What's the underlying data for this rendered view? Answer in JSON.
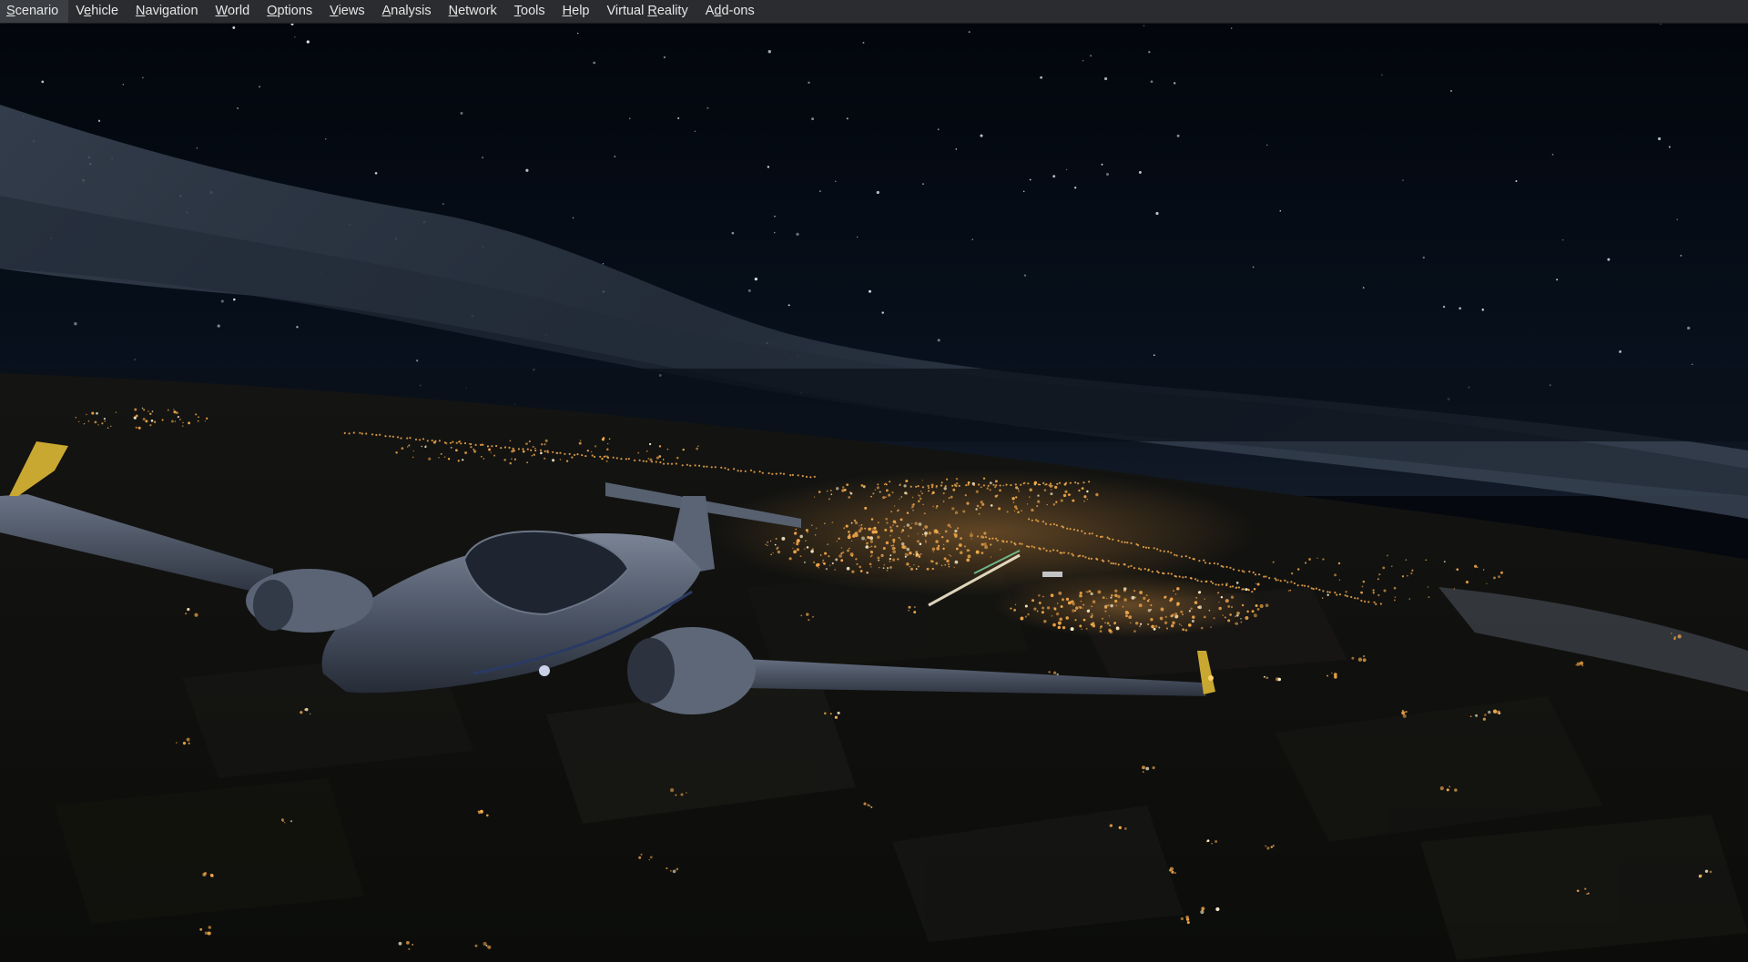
{
  "menubar": {
    "items": [
      {
        "pre": "",
        "key": "S",
        "post": "cenario",
        "name": "menu-scenario"
      },
      {
        "pre": "V",
        "key": "e",
        "post": "hicle",
        "name": "menu-vehicle"
      },
      {
        "pre": "",
        "key": "N",
        "post": "avigation",
        "name": "menu-navigation"
      },
      {
        "pre": "",
        "key": "W",
        "post": "orld",
        "name": "menu-world"
      },
      {
        "pre": "",
        "key": "O",
        "post": "ptions",
        "name": "menu-options"
      },
      {
        "pre": "",
        "key": "V",
        "post": "iews",
        "name": "menu-views"
      },
      {
        "pre": "",
        "key": "A",
        "post": "nalysis",
        "name": "menu-analysis"
      },
      {
        "pre": "",
        "key": "N",
        "post": "etwork",
        "name": "menu-network"
      },
      {
        "pre": "",
        "key": "T",
        "post": "ools",
        "name": "menu-tools"
      },
      {
        "pre": "",
        "key": "H",
        "post": "elp",
        "name": "menu-help"
      },
      {
        "pre": "Virtual ",
        "key": "R",
        "post": "eality",
        "name": "menu-virtual-reality"
      },
      {
        "pre": "A",
        "key": "d",
        "post": "d-ons",
        "name": "menu-add-ons"
      }
    ]
  },
  "scene": {
    "description_icon": "simulator-3d-view",
    "colors": {
      "sky_top": "#040810",
      "sky_horizon": "#0d1827",
      "cloud": "#2b3644",
      "ground": "#0b0c0b",
      "city_light": "#f2a84a",
      "aircraft": "#4f5a6b",
      "wingtip": "#d8b53a"
    }
  }
}
